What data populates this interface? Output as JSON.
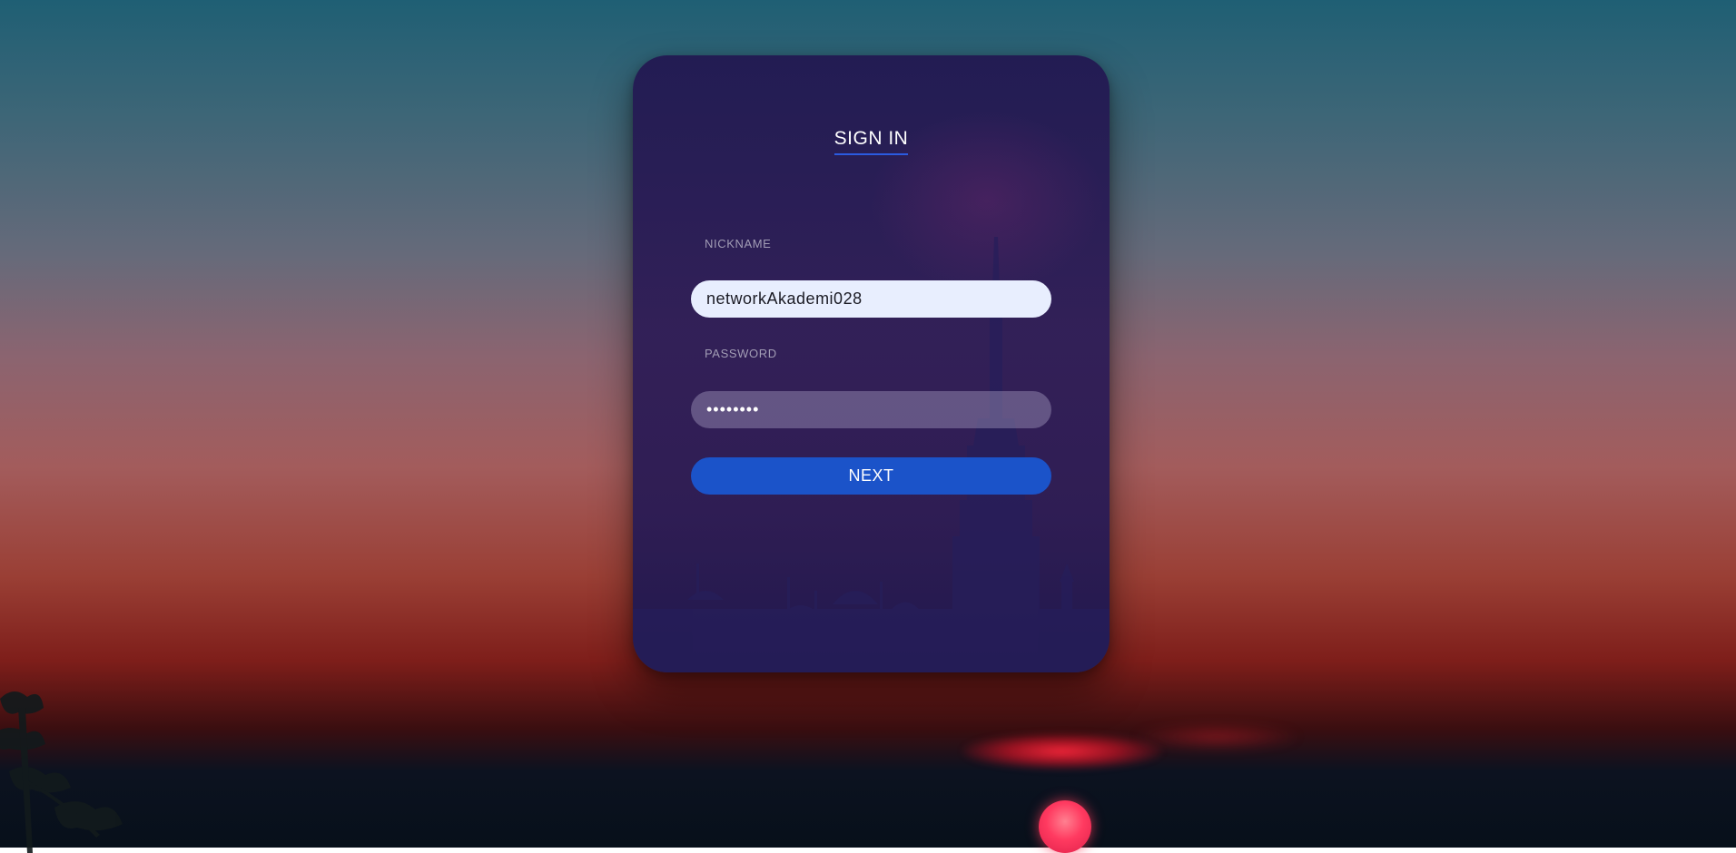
{
  "form": {
    "title": "SIGN IN",
    "nickname_label": "NICKNAME",
    "nickname_value": "networkAkademi028",
    "password_label": "PASSWORD",
    "password_value": "••••••••",
    "next_label": "NEXT"
  },
  "colors": {
    "accent": "#1b53c9",
    "title_underline": "#2b5be0",
    "card": "#2a1b54"
  }
}
